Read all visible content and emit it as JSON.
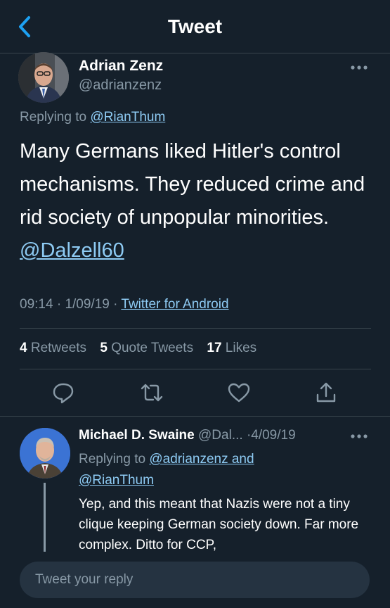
{
  "header": {
    "title": "Tweet",
    "back_icon": "chevron-left-icon"
  },
  "tweet": {
    "author_name": "Adrian Zenz",
    "author_handle": "@adrianzenz",
    "replying_prefix": "Replying to",
    "replying_to": "@RianThum",
    "text": "Many Germans liked Hitler's control mechanisms. They reduced crime and rid society of unpopular minorities.",
    "text_mention": "@Dalzell60",
    "time": "09:14",
    "date": "1/09/19",
    "source": "Twitter for Android",
    "stats": {
      "retweets_count": "4",
      "retweets_label": "Retweets",
      "quotes_count": "5",
      "quotes_label": "Quote Tweets",
      "likes_count": "17",
      "likes_label": "Likes"
    }
  },
  "reply": {
    "author_name": "Michael D. Swaine",
    "author_handle": "@Dal...",
    "date": "4/09/19",
    "replying_prefix": "Replying to",
    "replying_to": "@adrianzenz and @RianThum",
    "text": "Yep, and this meant that Nazis were not a tiny clique keeping German society down.  Far more complex.  Ditto for CCP,"
  },
  "compose": {
    "placeholder": "Tweet your reply"
  },
  "colors": {
    "background": "#15202b",
    "accent": "#1da1f2",
    "link": "#8ecbf4",
    "secondary": "#8899a6"
  }
}
